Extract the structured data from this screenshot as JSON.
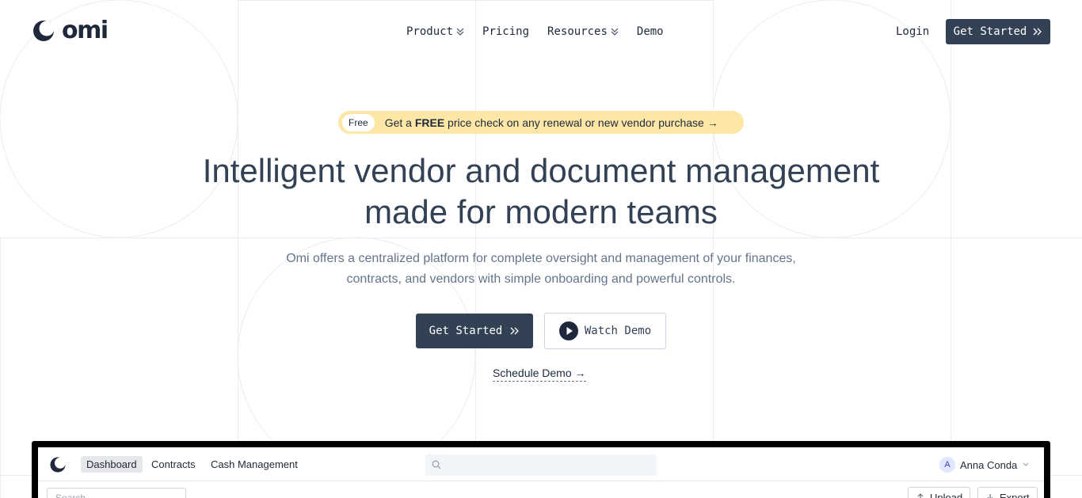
{
  "brand": {
    "name": "omi",
    "color": "#1e293b"
  },
  "nav": {
    "items": [
      {
        "label": "Product",
        "has_dropdown": true
      },
      {
        "label": "Pricing",
        "has_dropdown": false
      },
      {
        "label": "Resources",
        "has_dropdown": true
      },
      {
        "label": "Demo",
        "has_dropdown": false
      }
    ],
    "login_label": "Login",
    "cta_label": "Get Started"
  },
  "hero": {
    "promo_badge": "Free",
    "promo_prefix": "Get a ",
    "promo_bold": "FREE",
    "promo_suffix": " price check on any renewal or new vendor purchase →",
    "headline_line1": "Intelligent vendor and document management",
    "headline_line2": "made for modern teams",
    "subhead_line1": "Omi offers a centralized platform for complete oversight and management of your finances,",
    "subhead_line2": "contracts, and vendors with simple onboarding and powerful controls.",
    "primary_cta": "Get Started",
    "secondary_cta": "Watch Demo",
    "schedule_link": "Schedule Demo →"
  },
  "preview": {
    "tabs": [
      "Dashboard",
      "Contracts",
      "Cash Management"
    ],
    "active_tab": "Dashboard",
    "search_placeholder": "",
    "user_initial": "A",
    "user_name": "Anna Conda",
    "filter_placeholder": "Search",
    "upload_label": "Upload",
    "export_label": "Export"
  },
  "colors": {
    "primary": "#334155",
    "promo_bg": "#fde7a7",
    "text_muted": "#64748b"
  }
}
